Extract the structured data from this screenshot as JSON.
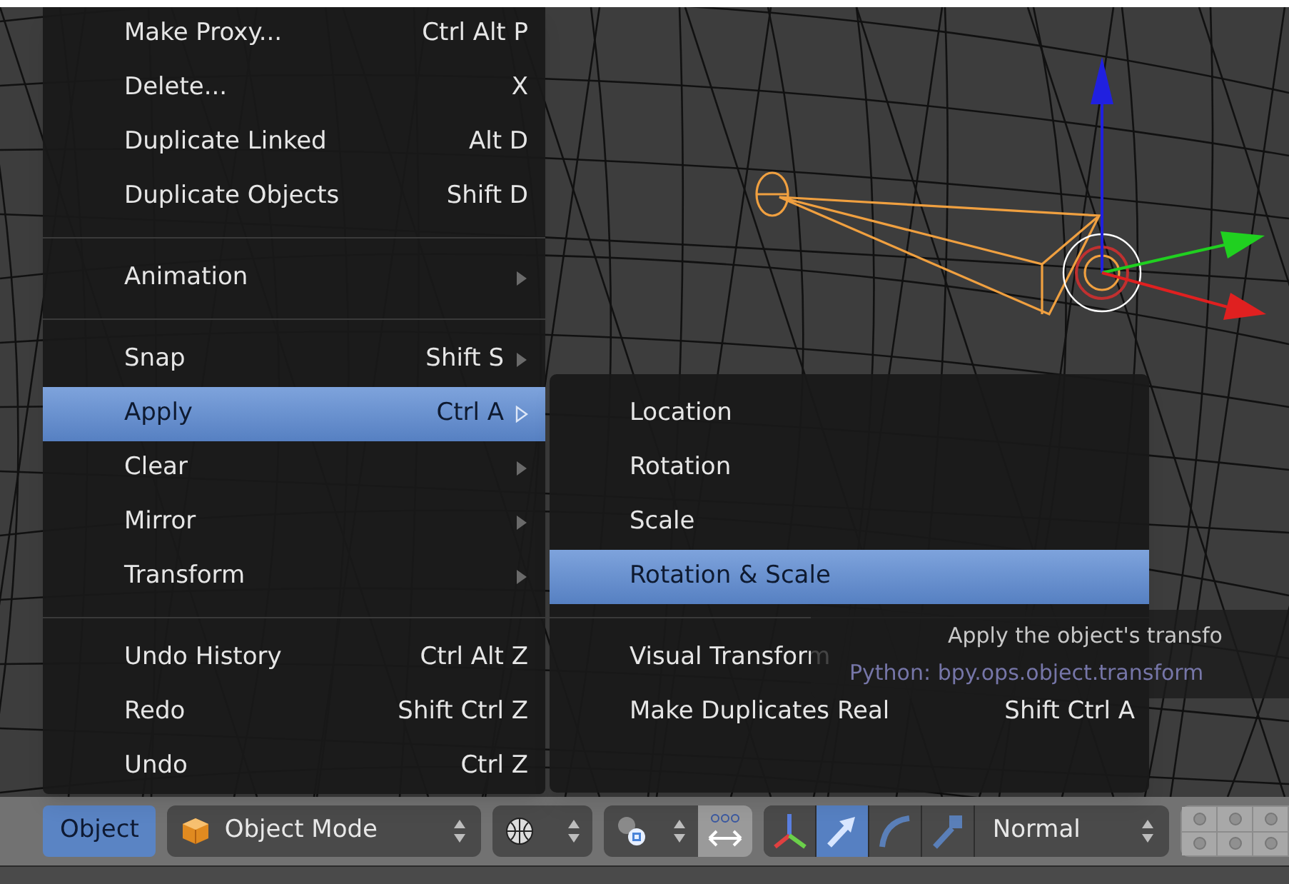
{
  "menu": {
    "items": [
      {
        "kind": "item",
        "label": "Make Proxy...",
        "shortcut": "Ctrl Alt P",
        "submenu": false,
        "selected": false
      },
      {
        "kind": "item",
        "label": "Delete...",
        "shortcut": "X",
        "submenu": false,
        "selected": false
      },
      {
        "kind": "item",
        "label": "Duplicate Linked",
        "shortcut": "Alt D",
        "submenu": false,
        "selected": false
      },
      {
        "kind": "item",
        "label": "Duplicate Objects",
        "shortcut": "Shift D",
        "submenu": false,
        "selected": false
      },
      {
        "kind": "separator"
      },
      {
        "kind": "item",
        "label": "Animation",
        "submenu": true,
        "selected": false
      },
      {
        "kind": "separator"
      },
      {
        "kind": "item",
        "label": "Snap",
        "shortcut": "Shift S",
        "submenu": true,
        "selected": false
      },
      {
        "kind": "item",
        "label": "Apply",
        "shortcut": "Ctrl A",
        "submenu": true,
        "selected": true
      },
      {
        "kind": "item",
        "label": "Clear",
        "submenu": true,
        "selected": false
      },
      {
        "kind": "item",
        "label": "Mirror",
        "submenu": true,
        "selected": false
      },
      {
        "kind": "item",
        "label": "Transform",
        "submenu": true,
        "selected": false
      },
      {
        "kind": "separator"
      },
      {
        "kind": "item",
        "label": "Undo History",
        "shortcut": "Ctrl Alt Z",
        "submenu": false,
        "selected": false
      },
      {
        "kind": "item",
        "label": "Redo",
        "shortcut": "Shift Ctrl Z",
        "submenu": false,
        "selected": false
      },
      {
        "kind": "item",
        "label": "Undo",
        "shortcut": "Ctrl Z",
        "submenu": false,
        "selected": false
      }
    ]
  },
  "submenu": {
    "items": [
      {
        "kind": "item",
        "label": "Location",
        "submenu": false,
        "selected": false
      },
      {
        "kind": "item",
        "label": "Rotation",
        "submenu": false,
        "selected": false
      },
      {
        "kind": "item",
        "label": "Scale",
        "submenu": false,
        "selected": false
      },
      {
        "kind": "item",
        "label": "Rotation & Scale",
        "submenu": false,
        "selected": true
      },
      {
        "kind": "separator"
      },
      {
        "kind": "item",
        "label": "Visual Transform",
        "submenu": false,
        "selected": false
      },
      {
        "kind": "item",
        "label": "Make Duplicates Real",
        "shortcut": "Shift Ctrl A",
        "submenu": false,
        "selected": false
      }
    ]
  },
  "tooltip": {
    "description": "Apply the object's transfo",
    "python": "Python: bpy.ops.object.transform"
  },
  "header": {
    "menu_button": {
      "label": "Object",
      "selected": true
    },
    "mode_dropdown": {
      "label": "Object Mode"
    },
    "transform_tools": [
      {
        "kind": "axes",
        "selected": false
      },
      {
        "kind": "translate",
        "selected": true
      },
      {
        "kind": "rotate",
        "selected": false
      },
      {
        "kind": "scale",
        "selected": false
      }
    ],
    "orientation_dropdown": {
      "label": "Normal"
    }
  }
}
